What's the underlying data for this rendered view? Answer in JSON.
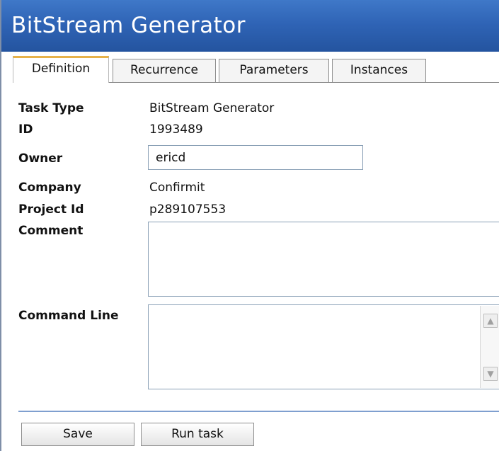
{
  "window": {
    "title": "BitStream Generator"
  },
  "tabs": [
    {
      "label": "Definition",
      "active": true
    },
    {
      "label": "Recurrence",
      "active": false
    },
    {
      "label": "Parameters",
      "active": false
    },
    {
      "label": "Instances",
      "active": false
    }
  ],
  "fields": {
    "task_type": {
      "label": "Task Type",
      "value": "BitStream Generator"
    },
    "id": {
      "label": "ID",
      "value": "1993489"
    },
    "owner": {
      "label": "Owner",
      "value": "ericd"
    },
    "company": {
      "label": "Company",
      "value": "Confirmit"
    },
    "project_id": {
      "label": "Project Id",
      "value": "p289107553"
    },
    "comment": {
      "label": "Comment",
      "value": ""
    },
    "command_line": {
      "label": "Command Line",
      "value": ""
    }
  },
  "buttons": {
    "save": "Save",
    "run_task": "Run task"
  },
  "icons": {
    "scroll_up": "scroll-up-arrow-icon",
    "scroll_down": "scroll-down-arrow-icon"
  },
  "colors": {
    "titlebar": "#2f64b6",
    "active_tab_accent": "#e7b24a",
    "divider": "#7f9fcf"
  }
}
